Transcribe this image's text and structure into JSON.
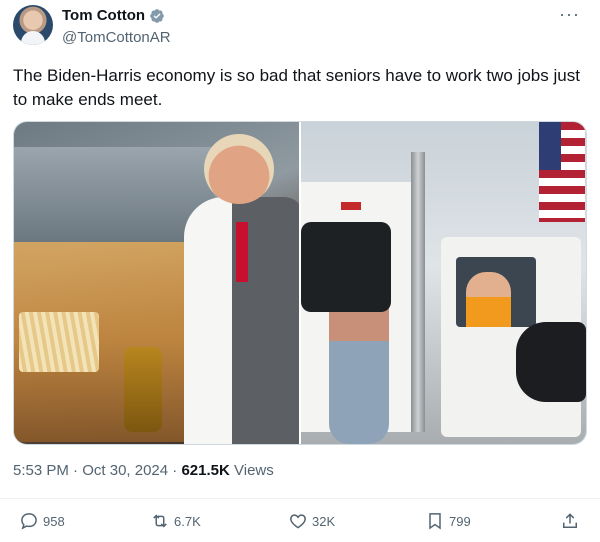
{
  "author": {
    "display_name": "Tom Cotton",
    "handle": "@TomCottonAR",
    "verified": true
  },
  "tweet": {
    "text": "The Biden-Harris economy is so bad that seniors have to work two jobs just to make ends meet.",
    "time": "5:53 PM",
    "separator": "·",
    "date": "Oct 30, 2024",
    "views_count": "621.5K",
    "views_label": "Views"
  },
  "actions": {
    "replies": "958",
    "reposts": "6.7K",
    "likes": "32K",
    "bookmarks": "799"
  },
  "colors": {
    "text_primary": "#0f1419",
    "text_secondary": "#536471",
    "verified_badge": "#829aab",
    "divider": "#eff3f4"
  },
  "icons": [
    "verified-badge-icon",
    "more-icon",
    "reply-icon",
    "repost-icon",
    "like-icon",
    "bookmark-icon",
    "share-icon"
  ]
}
